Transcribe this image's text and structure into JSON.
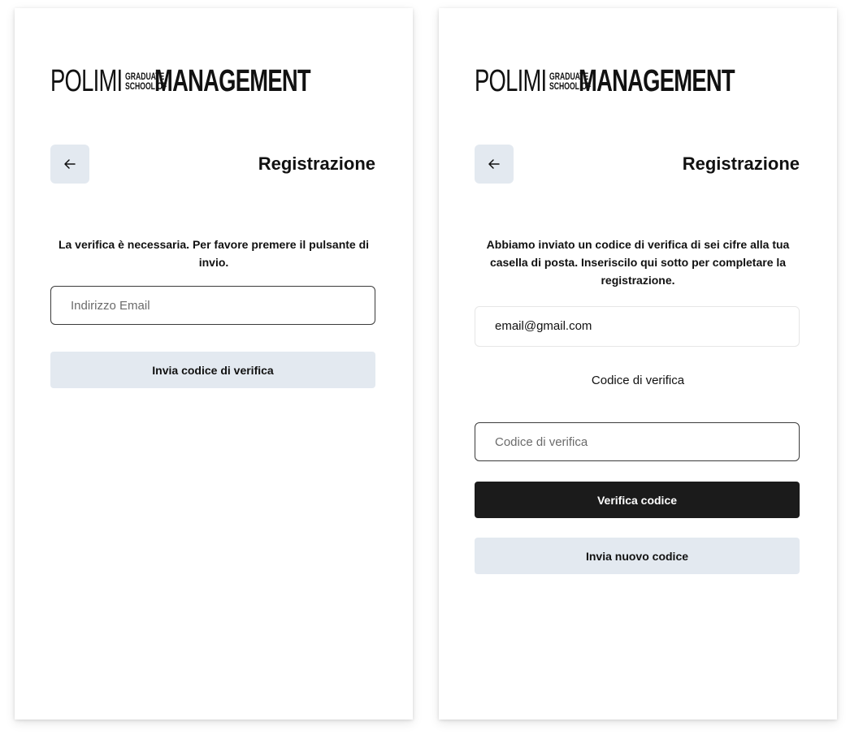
{
  "brand": {
    "word1": "POLIMI",
    "line1": "GRADUATE",
    "line2": "SCHOOL OF",
    "word2": "MANAGEMENT"
  },
  "colors": {
    "secondary_button_bg": "#e3e9f0",
    "primary_button_bg": "#1b1b1b",
    "input_border": "#3b3b3b"
  },
  "left": {
    "title": "Registrazione",
    "back_icon": "arrow-left-icon",
    "message": "La verifica è necessaria. Per favore premere il pulsante di invio.",
    "email_placeholder": "Indirizzo Email",
    "send_button": "Invia codice di verifica"
  },
  "right": {
    "title": "Registrazione",
    "back_icon": "arrow-left-icon",
    "message": "Abbiamo inviato un codice di verifica di sei cifre alla tua casella di posta. Inseriscilo qui sotto per completare la registrazione.",
    "email_value": "email@gmail.com",
    "code_label": "Codice di verifica",
    "code_placeholder": "Codice di verifica",
    "verify_button": "Verifica codice",
    "resend_button": "Invia nuovo codice"
  }
}
